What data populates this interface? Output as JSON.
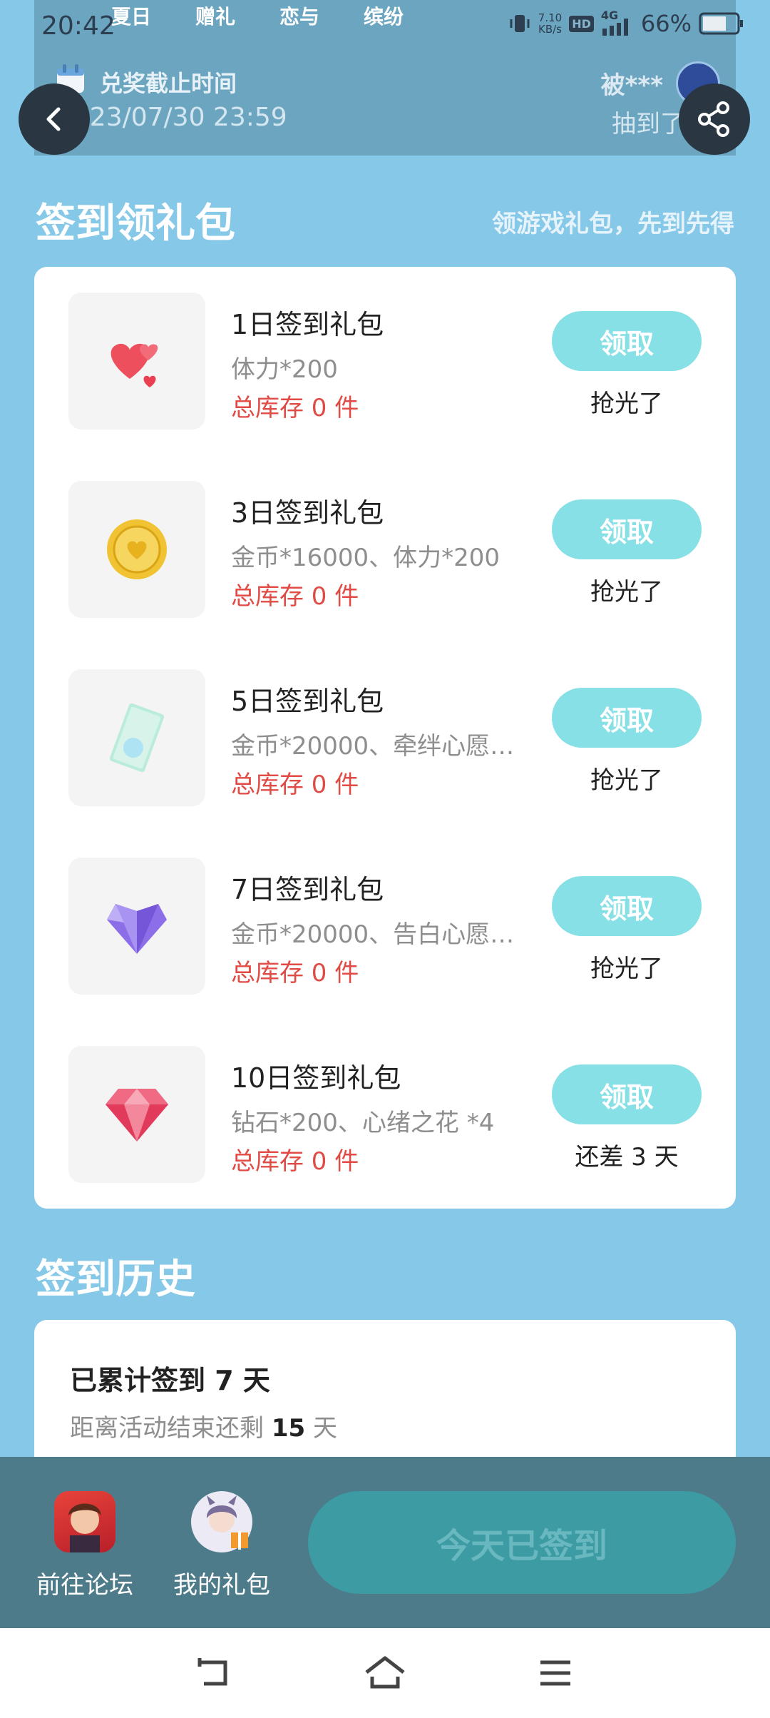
{
  "status": {
    "time": "20:42",
    "speed_top": "7.10",
    "speed_unit": "KB/s",
    "hd": "HD",
    "net": "4G",
    "battery": "66%"
  },
  "banner": {
    "tabs": [
      "夏日",
      "赠礼",
      "恋与",
      "缤纷"
    ],
    "deadline_label": "兑奖截止时间",
    "deadline_date": "2023/07/30 23:59",
    "winner_name": "被***",
    "winner_text": "抽到了夏"
  },
  "signin": {
    "title": "签到领礼包",
    "subtitle": "领游戏礼包，先到先得",
    "gifts": [
      {
        "title": "1日签到礼包",
        "desc": "体力*200",
        "stock": "总库存 0 件",
        "button": "领取",
        "status": "抢光了",
        "icon": "hearts-icon"
      },
      {
        "title": "3日签到礼包",
        "desc": "金币*16000、体力*200",
        "stock": "总库存 0 件",
        "button": "领取",
        "status": "抢光了",
        "icon": "gold-coin-icon"
      },
      {
        "title": "5日签到礼包",
        "desc": "金币*20000、牵绊心愿…",
        "stock": "总库存 0 件",
        "button": "领取",
        "status": "抢光了",
        "icon": "card-icon"
      },
      {
        "title": "7日签到礼包",
        "desc": "金币*20000、告白心愿…",
        "stock": "总库存 0 件",
        "button": "领取",
        "status": "抢光了",
        "icon": "purple-heart-gem-icon"
      },
      {
        "title": "10日签到礼包",
        "desc": "钻石*200、心绪之花 *4",
        "stock": "总库存 0 件",
        "button": "领取",
        "status": "还差 3 天",
        "icon": "red-diamond-icon"
      }
    ]
  },
  "history": {
    "title": "签到历史",
    "cumulative": "已累计签到 7 天",
    "remaining_prefix": "距离活动结束还剩",
    "remaining_days": "15",
    "remaining_suffix": "天"
  },
  "bottom": {
    "forum_label": "前往论坛",
    "gifts_label": "我的礼包",
    "signed_label": "今天已签到"
  }
}
